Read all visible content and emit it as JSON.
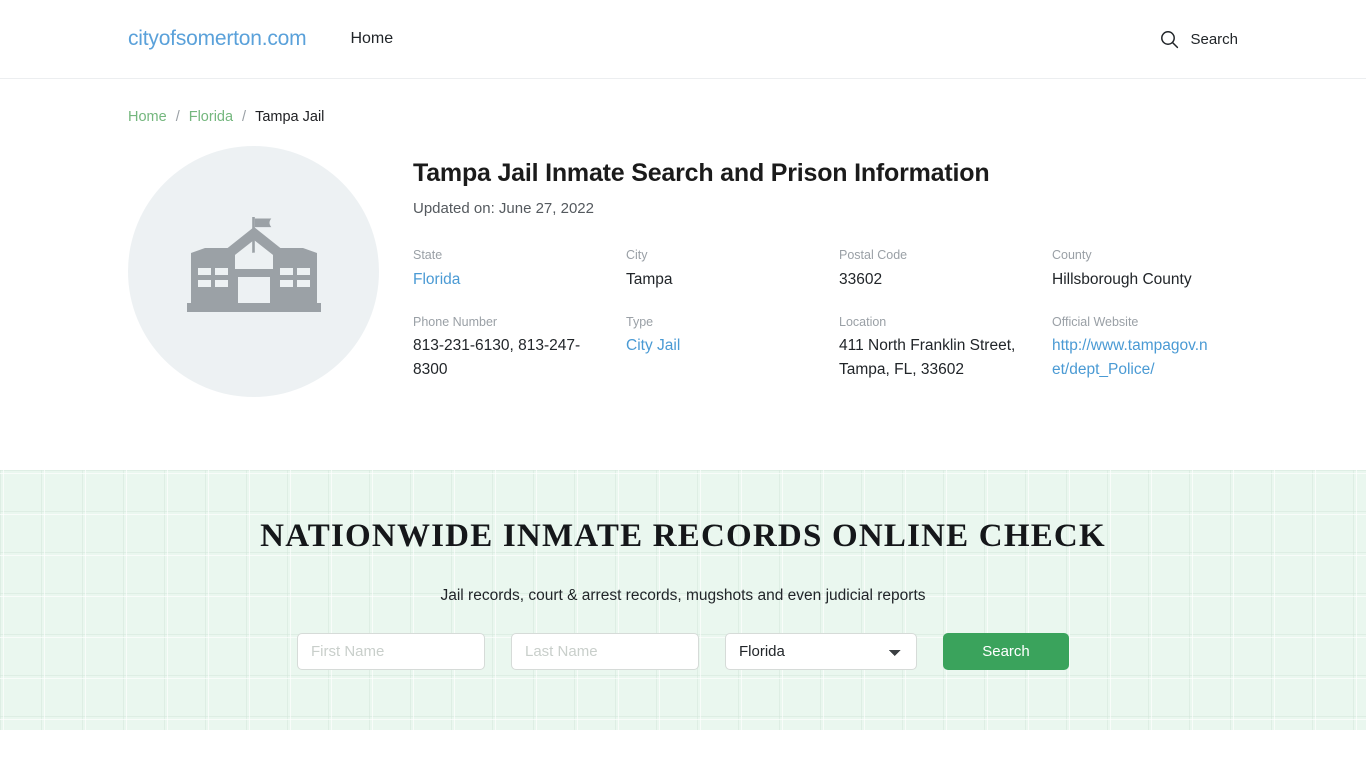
{
  "header": {
    "brand": "cityofsomerton.com",
    "nav": [
      {
        "label": "Home"
      }
    ],
    "search_label": "Search",
    "search_icon": "search-icon"
  },
  "breadcrumb": {
    "items": [
      {
        "label": "Home",
        "link": true
      },
      {
        "label": "Florida",
        "link": true
      },
      {
        "label": "Tampa Jail",
        "link": false
      }
    ],
    "separator": "/"
  },
  "facility": {
    "figure_icon": "courthouse-building-icon",
    "title": "Tampa Jail Inmate Search and Prison Information",
    "updated": "Updated on: June 27, 2022",
    "fields": [
      {
        "label": "State",
        "value": "Florida",
        "link": true
      },
      {
        "label": "City",
        "value": "Tampa",
        "link": false
      },
      {
        "label": "Postal Code",
        "value": "33602",
        "link": false
      },
      {
        "label": "County",
        "value": "Hillsborough County",
        "link": false
      },
      {
        "label": "Phone Number",
        "value": "813-231-6130, 813-247-8300",
        "link": false
      },
      {
        "label": "Type",
        "value": "City Jail",
        "link": true
      },
      {
        "label": "Location",
        "value": "411 North Franklin Street, Tampa, FL, 33602",
        "link": false
      },
      {
        "label": "Official Website",
        "value": "http://www.tampagov.net/dept_Police/",
        "link": true
      }
    ]
  },
  "promo": {
    "title": "NATIONWIDE INMATE RECORDS ONLINE CHECK",
    "subtitle": "Jail records, court & arrest records, mugshots and even judicial reports",
    "form": {
      "first_name_placeholder": "First Name",
      "first_name_value": "",
      "last_name_placeholder": "Last Name",
      "last_name_value": "",
      "state_selected": "Florida",
      "state_options": [
        "Florida"
      ],
      "submit_label": "Search"
    }
  },
  "colors": {
    "brand": "#5aa1da",
    "breadcrumb_link": "#74b77e",
    "link": "#4a9ad4",
    "promo_bg": "#eaf7ef",
    "button_green": "#3aa35c",
    "figure_bg": "#edf1f3"
  }
}
